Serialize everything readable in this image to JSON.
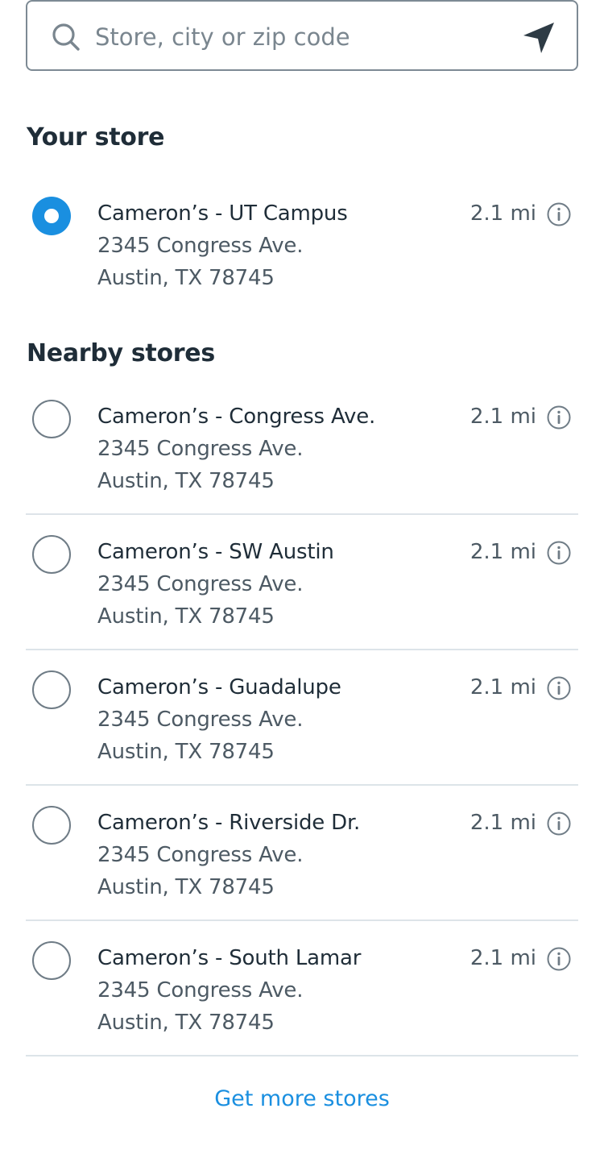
{
  "search": {
    "placeholder": "Store, city or zip code",
    "search_icon": "search-icon",
    "location_icon": "location-arrow-icon"
  },
  "your_store": {
    "title": "Your store",
    "store": {
      "name": "Cameron’s - UT Campus",
      "address1": "2345 Congress Ave.",
      "address2": "Austin, TX 78745",
      "distance": "2.1 mi",
      "selected": true
    }
  },
  "nearby": {
    "title": "Nearby stores",
    "stores": [
      {
        "name": "Cameron’s - Congress Ave.",
        "address1": "2345 Congress Ave.",
        "address2": "Austin, TX 78745",
        "distance": "2.1 mi",
        "selected": false
      },
      {
        "name": "Cameron’s - SW Austin",
        "address1": "2345 Congress Ave.",
        "address2": "Austin, TX 78745",
        "distance": "2.1 mi",
        "selected": false
      },
      {
        "name": "Cameron’s - Guadalupe",
        "address1": "2345 Congress Ave.",
        "address2": "Austin, TX 78745",
        "distance": "2.1 mi",
        "selected": false
      },
      {
        "name": "Cameron’s - Riverside Dr.",
        "address1": "2345 Congress Ave.",
        "address2": "Austin, TX 78745",
        "distance": "2.1 mi",
        "selected": false
      },
      {
        "name": "Cameron’s - South Lamar",
        "address1": "2345 Congress Ave.",
        "address2": "Austin, TX 78745",
        "distance": "2.1 mi",
        "selected": false
      }
    ]
  },
  "more_link": "Get more stores",
  "colors": {
    "accent": "#1a8fe0",
    "text": "#1f2d38",
    "secondary_text": "#4d5a64",
    "divider": "#dde4e9"
  }
}
